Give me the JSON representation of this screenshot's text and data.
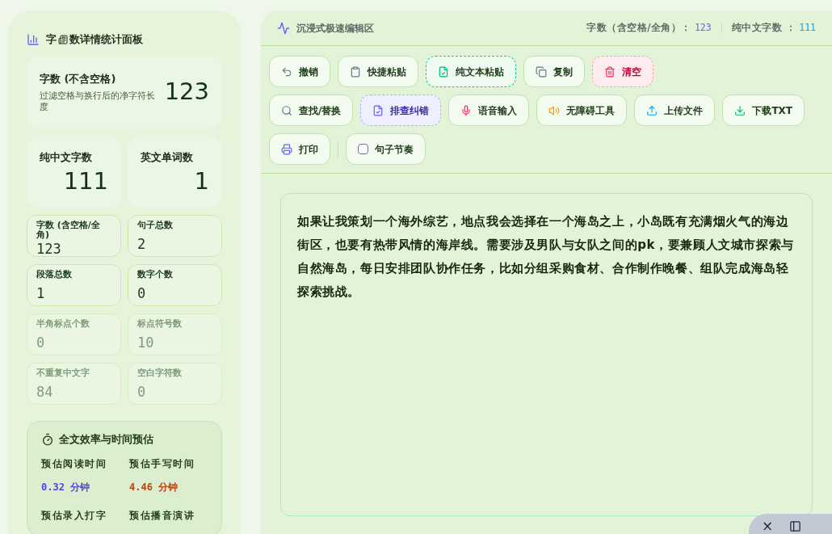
{
  "sidebar": {
    "title_parts": [
      "字",
      "数详情统计面板"
    ],
    "hero": {
      "label": "字数 (不含空格)",
      "description": "过滤空格与换行后的净字符长度",
      "value": "123"
    },
    "big_stats": [
      {
        "label": "纯中文字数",
        "value": "111"
      },
      {
        "label": "英文单词数",
        "value": "1"
      }
    ],
    "small_stats": [
      {
        "label": "字数 (含空格/全角)",
        "value": "123",
        "muted": false
      },
      {
        "label": "句子总数",
        "value": "2",
        "muted": false
      },
      {
        "label": "段落总数",
        "value": "1",
        "muted": false
      },
      {
        "label": "数字个数",
        "value": "0",
        "muted": false
      },
      {
        "label": "半角标点个数",
        "value": "0",
        "muted": true
      },
      {
        "label": "标点符号数",
        "value": "10",
        "muted": true
      },
      {
        "label": "不重复中文字",
        "value": "84",
        "muted": true
      },
      {
        "label": "空白字符数",
        "value": "0",
        "muted": true
      }
    ],
    "estimate": {
      "title": "全文效率与时间预估",
      "items": [
        {
          "label": "预估阅读时间",
          "value": "0.32",
          "unit": "分钟",
          "color": "#4f46e5"
        },
        {
          "label": "预估手写时间",
          "value": "4.46",
          "unit": "分钟",
          "color": "#c2410c"
        },
        {
          "label": "预估录入打字"
        },
        {
          "label": "预估播音演讲"
        }
      ]
    }
  },
  "editor": {
    "title": "沉浸式极速编辑区",
    "counters": [
      {
        "label": "字数（含空格/全角）：",
        "value": "123",
        "color": "#6366f1"
      },
      {
        "label": "纯中文字数 ：",
        "value": "111",
        "color": "#0ea5e9"
      }
    ],
    "toolbar": [
      [
        {
          "kind": "button",
          "label": "撤销"
        },
        {
          "kind": "button",
          "label": "快捷粘贴"
        },
        {
          "kind": "button",
          "label": "纯文本粘贴"
        },
        {
          "kind": "button",
          "label": "复制"
        },
        {
          "kind": "button",
          "label": "清空"
        }
      ],
      [
        {
          "kind": "button",
          "label": "查找/替换"
        },
        {
          "kind": "button",
          "label": "排查纠错"
        },
        {
          "kind": "button",
          "label": "语音输入"
        },
        {
          "kind": "button",
          "label": "无障碍工具"
        },
        {
          "kind": "button",
          "label": "上传文件"
        },
        {
          "kind": "button",
          "label": "下载TXT"
        }
      ],
      [
        {
          "kind": "button",
          "label": "打印"
        },
        {
          "kind": "divider"
        },
        {
          "kind": "checkbox",
          "label": "句子节奏",
          "checked": false
        }
      ]
    ],
    "text": "如果让我策划一个海外综艺，地点我会选择在一个海岛之上，小岛既有充满烟火气的海边街区，也要有热带风情的海岸线。需要涉及男队与女队之间的pk，要兼顾人文城市探索与自然海岛，每日安排团队协作任务，比如分组采购食材、合作制作晚餐、组队完成海岛轻探索挑战。"
  },
  "floating_bar": {
    "close": "×"
  }
}
